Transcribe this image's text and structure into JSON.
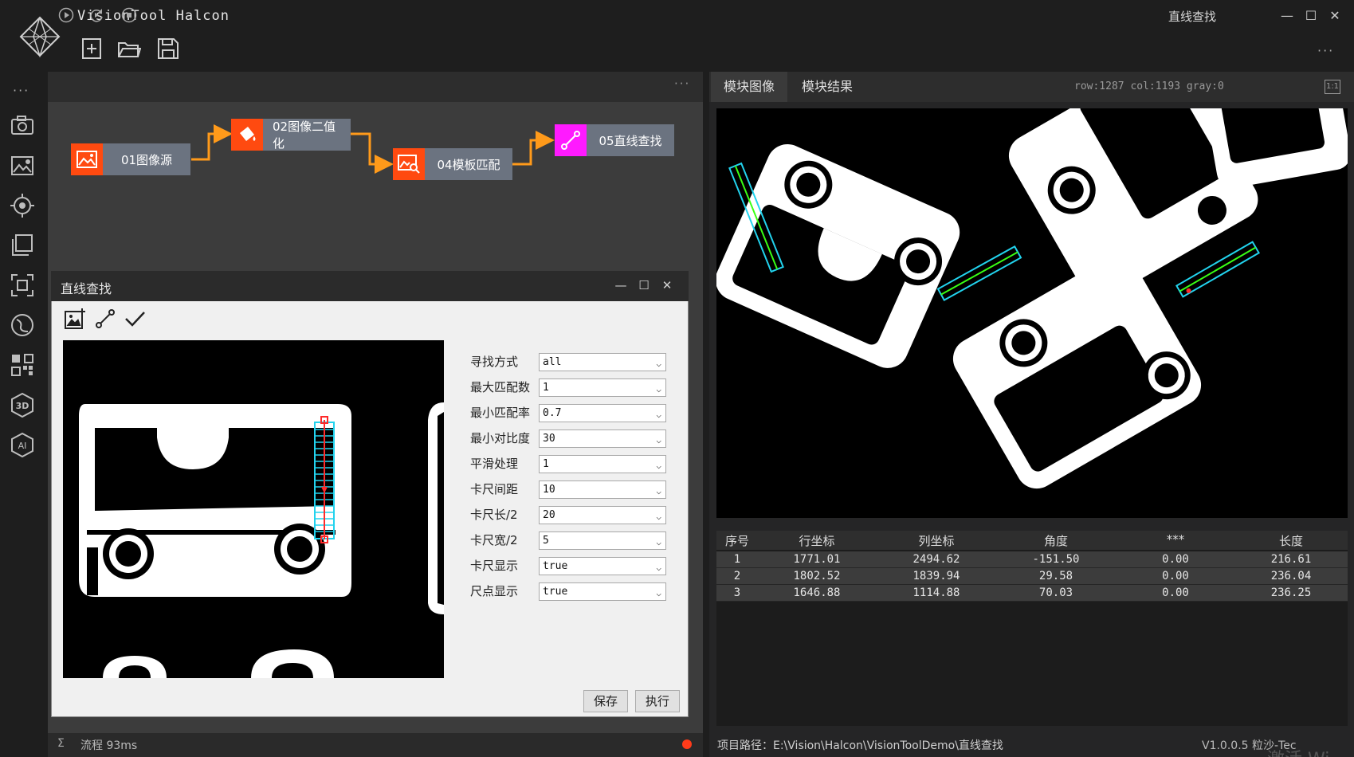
{
  "app": {
    "title": "VisionTool Halcon",
    "window_caption": "直线查找",
    "minimize": "—",
    "maximize": "☐",
    "close": "✕",
    "more": "···"
  },
  "toolbar": {
    "icons": [
      "new-file-icon",
      "open-folder-icon",
      "save-icon"
    ]
  },
  "sidebar": {
    "more": "···",
    "icons": [
      "camera-icon",
      "image-settings-icon",
      "target-icon",
      "layers-icon",
      "measure-icon",
      "curve-icon",
      "qrcode-icon",
      "3d-icon",
      "ai-icon"
    ],
    "ai_label": "AI",
    "3d_label": "3D"
  },
  "flow": {
    "controls": [
      "play-icon",
      "loop-icon",
      "stop-icon"
    ],
    "more": "···",
    "nodes": [
      {
        "label": "01图像源",
        "color": "#ff4a10"
      },
      {
        "label": "02图像二值化",
        "color": "#ff4a10"
      },
      {
        "label": "04模板匹配",
        "color": "#ff4a10"
      },
      {
        "label": "05直线查找",
        "color": "#ff1aff"
      }
    ],
    "connector_color": "#ff9a1a"
  },
  "dialog": {
    "title": "直线查找",
    "minimize": "—",
    "maximize": "☐",
    "close": "✕",
    "params": [
      {
        "label": "寻找方式",
        "value": "all"
      },
      {
        "label": "最大匹配数",
        "value": "1"
      },
      {
        "label": "最小匹配率",
        "value": "0.7"
      },
      {
        "label": "最小对比度",
        "value": "30"
      },
      {
        "label": "平滑处理",
        "value": "1"
      },
      {
        "label": "卡尺间距",
        "value": "10"
      },
      {
        "label": "卡尺长/2",
        "value": "20"
      },
      {
        "label": "卡尺宽/2",
        "value": "5"
      },
      {
        "label": "卡尺显示",
        "value": "true"
      },
      {
        "label": "尺点显示",
        "value": "true"
      }
    ],
    "save_label": "保存",
    "run_label": "执行"
  },
  "status_left": {
    "sigma": "Σ",
    "text": "流程 93ms"
  },
  "right": {
    "tabs": [
      "模块图像",
      "模块结果"
    ],
    "pixel_info": "row:1287 col:1193 gray:0",
    "fit_label": "1:1",
    "table": {
      "headers": [
        "序号",
        "行坐标",
        "列坐标",
        "角度",
        "***",
        "长度"
      ],
      "rows": [
        [
          "1",
          "1771.01",
          "2494.62",
          "-151.50",
          "0.00",
          "216.61"
        ],
        [
          "2",
          "1802.52",
          "1839.94",
          "29.58",
          "0.00",
          "236.04"
        ],
        [
          "3",
          "1646.88",
          "1114.88",
          "70.03",
          "0.00",
          "236.25"
        ]
      ]
    },
    "project_path": "项目路径：E:\\Vision\\Halcon\\VisionToolDemo\\直线查找",
    "version": "V1.0.0.5 粒沙-Tec",
    "watermark": "激活 Wi"
  },
  "colors": {
    "caliper": "#22d3ee",
    "edge_line": "#39ff14",
    "edge_point": "#ff2a2a"
  }
}
